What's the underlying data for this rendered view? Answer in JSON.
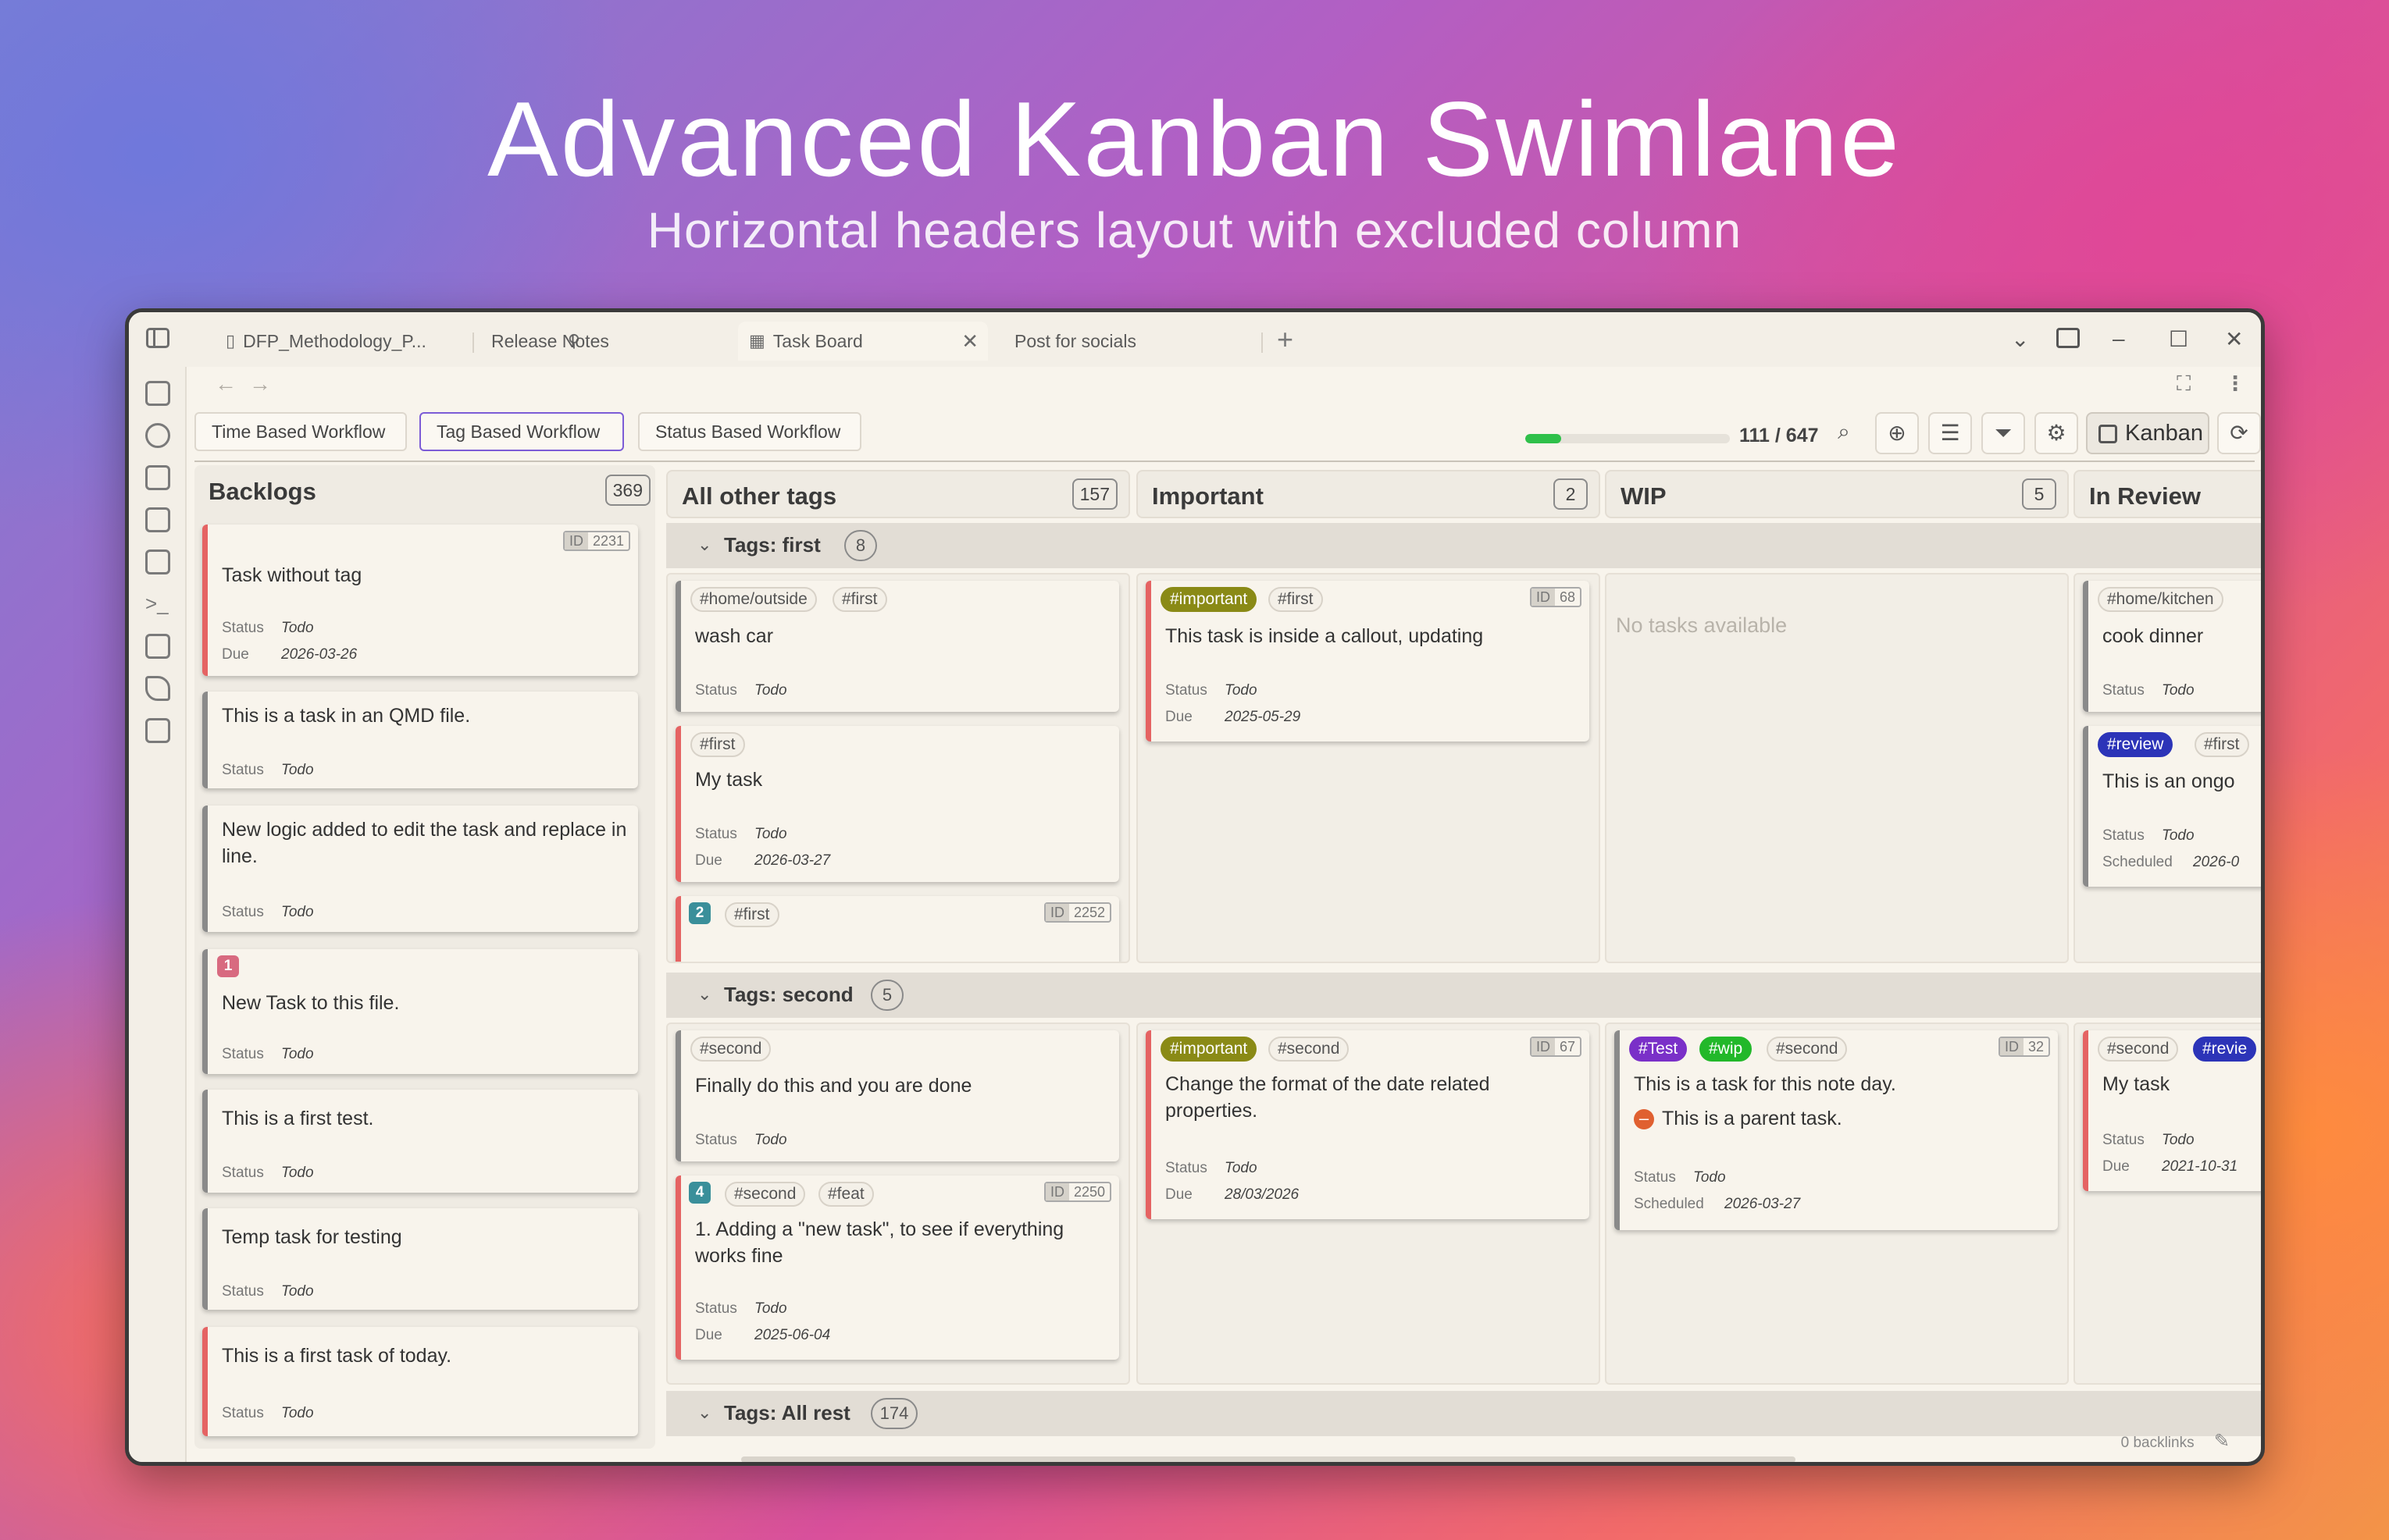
{
  "hero": {
    "title": "Advanced Kanban Swimlane",
    "subtitle": "Horizontal headers layout with excluded column"
  },
  "tabs": [
    {
      "label": "DFP_Methodology_P...",
      "icon": "file-icon",
      "pinned": true
    },
    {
      "label": "Release Notes",
      "icon": "none",
      "pinned": true
    },
    {
      "label": "Task Board",
      "icon": "table-icon",
      "active": true
    },
    {
      "label": "Post for socials",
      "icon": "none"
    }
  ],
  "workflows": [
    {
      "label": "Time Based Workflow"
    },
    {
      "label": "Tag Based Workflow",
      "active": true
    },
    {
      "label": "Status Based Workflow"
    }
  ],
  "progress": {
    "done": 111,
    "total": 647,
    "text": "111 / 647"
  },
  "toolbar": {
    "kanban_label": "Kanban"
  },
  "columns": {
    "backlogs": {
      "title": "Backlogs",
      "count": "369"
    },
    "all_other": {
      "title": "All other tags",
      "count": "157"
    },
    "important": {
      "title": "Important",
      "count": "2"
    },
    "wip": {
      "title": "WIP",
      "count": "5"
    },
    "in_review": {
      "title": "In Review"
    }
  },
  "lanes": {
    "first": {
      "label": "Tags: first",
      "count": "8"
    },
    "second": {
      "label": "Tags: second",
      "count": "5"
    },
    "rest": {
      "label": "Tags: All rest",
      "count": "174"
    }
  },
  "labels": {
    "status": "Status",
    "due": "Due",
    "scheduled": "Scheduled",
    "todo": "Todo",
    "id": "ID"
  },
  "backlog_cards": [
    {
      "title": "Task without tag",
      "id": "2231",
      "due": "2026-03-26"
    },
    {
      "title": "This is a task in an QMD file."
    },
    {
      "title": "New logic added to edit the task and replace in line."
    },
    {
      "title": "New Task to this file.",
      "badge": "1"
    },
    {
      "title": "This is a first test."
    },
    {
      "title": "Temp task for testing"
    },
    {
      "title": "This is a first task of today."
    }
  ],
  "cards": {
    "wash_car": {
      "tags": [
        "#home/outside",
        "#first"
      ],
      "title": "wash car"
    },
    "my_task_1": {
      "tags": [
        "#first"
      ],
      "title": "My task",
      "due": "2026-03-27"
    },
    "temp_task": {
      "badge": "2",
      "tags": [
        "#first"
      ],
      "id": "2252"
    },
    "callout": {
      "tags": [
        "#important",
        "#first"
      ],
      "id": "68",
      "title": "This task is inside a callout, updating",
      "due": "2025-05-29"
    },
    "no_tasks": "No tasks available",
    "cook_dinner": {
      "tags": [
        "#home/kitchen"
      ],
      "title": "cook dinner"
    },
    "ongoing": {
      "tags": [
        "#review",
        "#first"
      ],
      "title": "This is an ongo",
      "scheduled": "2026-0"
    },
    "finally": {
      "tags": [
        "#second"
      ],
      "title": "Finally do this and you are done"
    },
    "adding": {
      "badge": "4",
      "tags": [
        "#second",
        "#feat"
      ],
      "id": "2250",
      "title": "1. Adding a \"new task\", to see if everything works fine",
      "due": "2025-06-04"
    },
    "date_format": {
      "tags": [
        "#important",
        "#second"
      ],
      "id": "67",
      "title": "Change the format of the date related properties.",
      "due": "28/03/2026"
    },
    "note_day": {
      "tags": [
        "#Test",
        "#wip",
        "#second"
      ],
      "id": "32",
      "title": "This is a task for this note day.",
      "subtitle": "This is a parent task.",
      "scheduled": "2026-03-27"
    },
    "my_task_2": {
      "tags": [
        "#second",
        "#revie"
      ],
      "title": "My task",
      "due": "2021-10-31"
    }
  },
  "statusbar": {
    "backlinks": "0 backlinks"
  },
  "colors": {
    "accent": "#7c5cd6",
    "card_border": "#e56363",
    "progress": "#2fc04a"
  }
}
